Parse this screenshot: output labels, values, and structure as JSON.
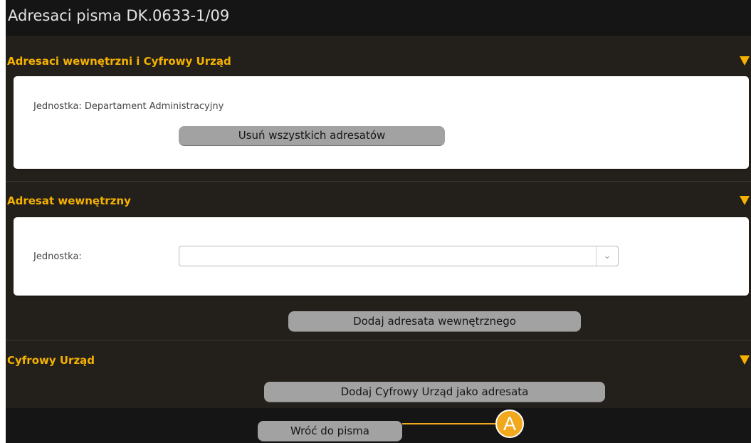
{
  "dialog": {
    "title": "Adresaci pisma DK.0633-1/09"
  },
  "sections": {
    "internal_and_digital": {
      "header": "Adresaci wewnętrzni i Cyfrowy Urząd",
      "unit_text": "Jednostka: Departament Administracyjny",
      "remove_all_label": "Usuń wszystkich adresatów"
    },
    "internal": {
      "header": "Adresat wewnętrzny",
      "unit_label": "Jednostka:",
      "unit_select_value": "",
      "add_label": "Dodaj adresata wewnętrznego"
    },
    "digital_office": {
      "header": "Cyfrowy Urząd",
      "add_label": "Dodaj Cyfrowy Urząd jako adresata"
    }
  },
  "footer": {
    "back_label": "Wróć do pisma"
  },
  "callout": {
    "label": "A",
    "color": "#f2a81d"
  },
  "colors": {
    "accent": "#f5b200",
    "background": "#231f1b",
    "title_bar": "#151515",
    "button": "#a2a2a2"
  },
  "icons": {
    "collapse": "triangle-down-icon",
    "select_dropdown": "chevron-down-icon"
  }
}
